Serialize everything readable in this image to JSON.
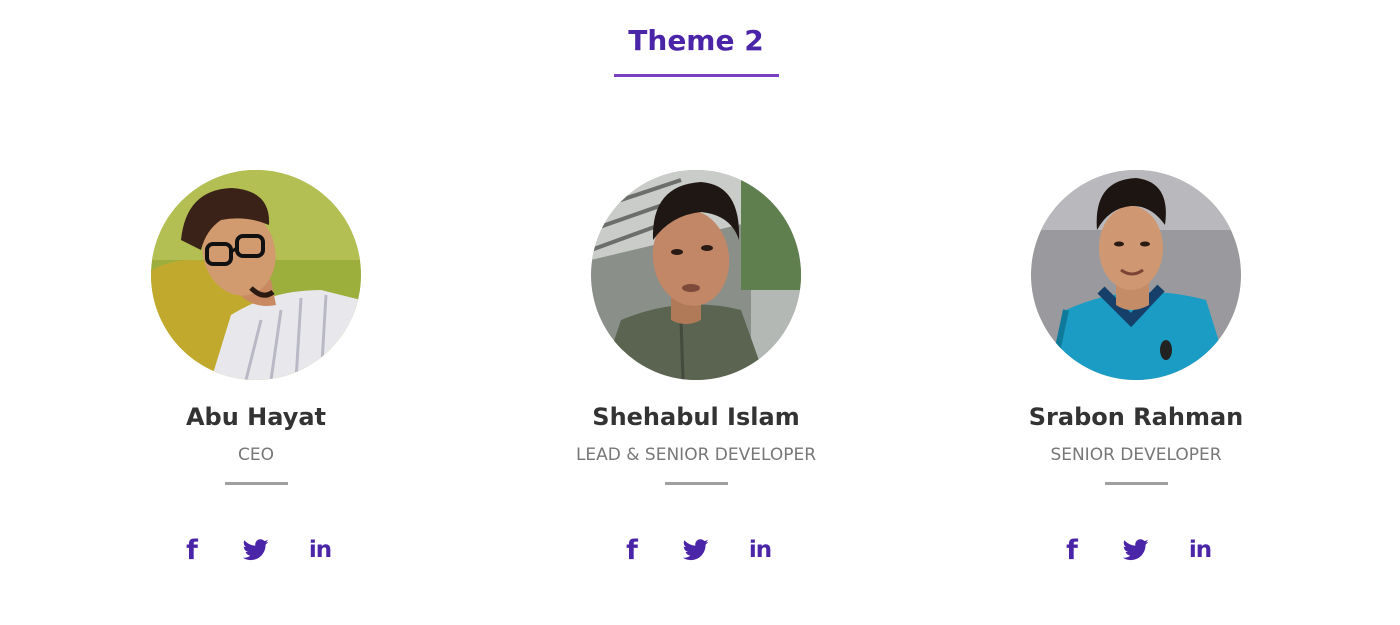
{
  "section": {
    "title": "Theme 2"
  },
  "team": [
    {
      "name": "Abu Hayat",
      "role": "CEO",
      "socials": {
        "facebook": "f",
        "twitter": "twitter-icon",
        "linkedin": "in"
      }
    },
    {
      "name": "Shehabul Islam",
      "role": "LEAD & SENIOR DEVELOPER",
      "socials": {
        "facebook": "f",
        "twitter": "twitter-icon",
        "linkedin": "in"
      }
    },
    {
      "name": "Srabon Rahman",
      "role": "SENIOR DEVELOPER",
      "socials": {
        "facebook": "f",
        "twitter": "twitter-icon",
        "linkedin": "in"
      }
    }
  ],
  "colors": {
    "accent": "#4a25a8",
    "underline": "#7b3fc4",
    "name": "#333333",
    "role": "#777777",
    "divider": "#a0a0a0"
  },
  "icons": [
    "facebook-icon",
    "twitter-icon",
    "linkedin-icon"
  ]
}
